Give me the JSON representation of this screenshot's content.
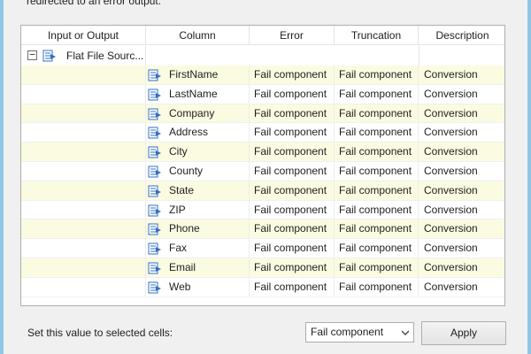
{
  "header": {
    "text": "redirected to an error output."
  },
  "grid": {
    "columns": [
      "Input or Output",
      "Column",
      "Error",
      "Truncation",
      "Description"
    ],
    "source": {
      "label": "Flat File Sourc...",
      "expander": "−"
    },
    "rows": [
      {
        "column": "FirstName",
        "error": "Fail component",
        "truncation": "Fail component",
        "description": "Conversion"
      },
      {
        "column": "LastName",
        "error": "Fail component",
        "truncation": "Fail component",
        "description": "Conversion"
      },
      {
        "column": "Company",
        "error": "Fail component",
        "truncation": "Fail component",
        "description": "Conversion"
      },
      {
        "column": "Address",
        "error": "Fail component",
        "truncation": "Fail component",
        "description": "Conversion"
      },
      {
        "column": "City",
        "error": "Fail component",
        "truncation": "Fail component",
        "description": "Conversion"
      },
      {
        "column": "County",
        "error": "Fail component",
        "truncation": "Fail component",
        "description": "Conversion"
      },
      {
        "column": "State",
        "error": "Fail component",
        "truncation": "Fail component",
        "description": "Conversion"
      },
      {
        "column": "ZIP",
        "error": "Fail component",
        "truncation": "Fail component",
        "description": "Conversion"
      },
      {
        "column": "Phone",
        "error": "Fail component",
        "truncation": "Fail component",
        "description": "Conversion"
      },
      {
        "column": "Fax",
        "error": "Fail component",
        "truncation": "Fail component",
        "description": "Conversion"
      },
      {
        "column": "Email",
        "error": "Fail component",
        "truncation": "Fail component",
        "description": "Conversion"
      },
      {
        "column": "Web",
        "error": "Fail component",
        "truncation": "Fail component",
        "description": "Conversion"
      }
    ]
  },
  "footer": {
    "label": "Set this value to selected cells:",
    "select_value": "Fail component",
    "apply_label": "Apply"
  },
  "icons": {
    "column_icon": "column-arrow-icon",
    "source_icon": "flat-file-source-icon"
  },
  "colors": {
    "alt_row": "#fbfbe1",
    "icon_blue": "#2f6fc4",
    "window_edge": "#8fc6e6"
  }
}
